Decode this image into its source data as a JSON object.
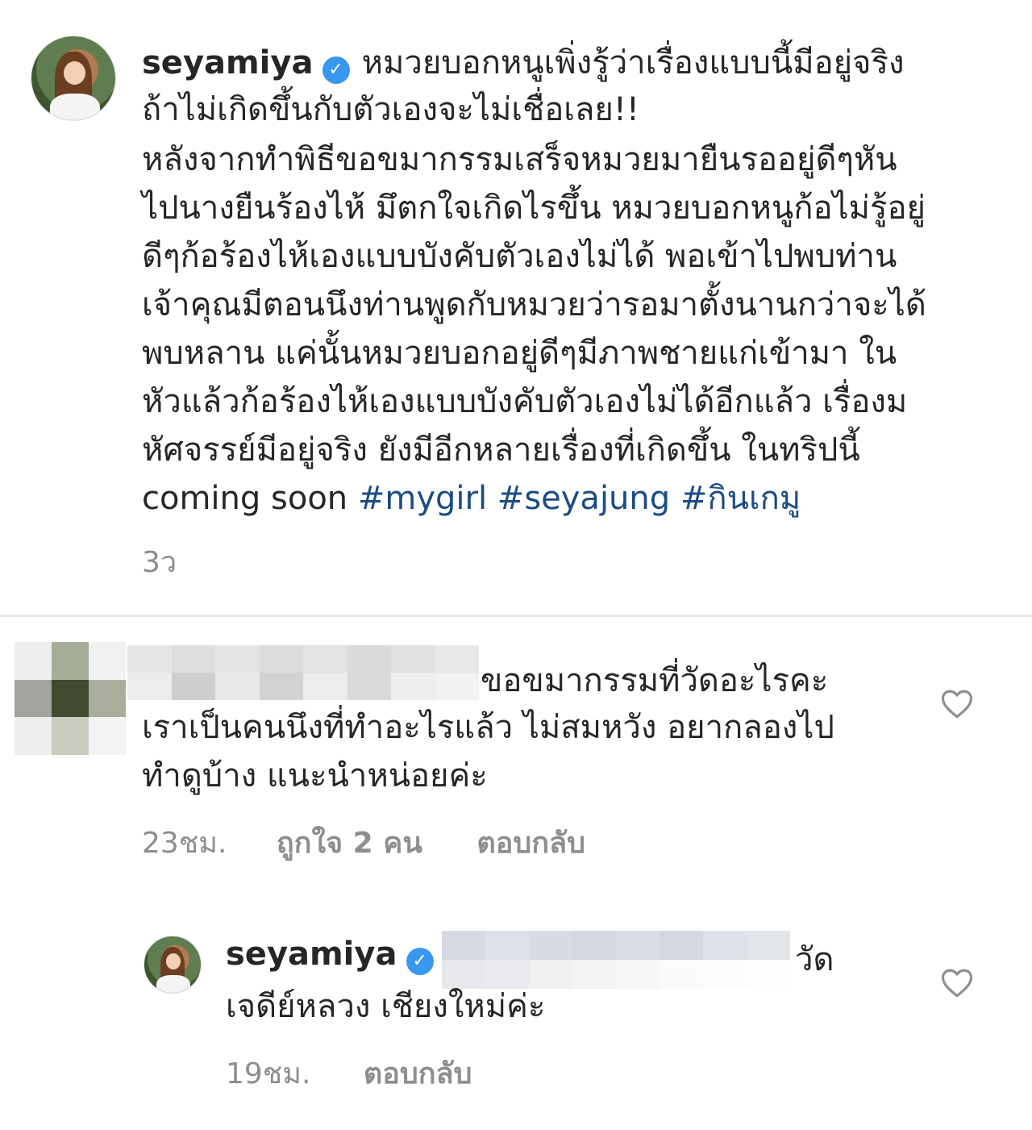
{
  "post": {
    "username": "seyamiya",
    "caption_lines": [
      "หมวยบอกหนูเพิ่งรู้ว่าเรื่องแบบนี้มีอยู่จริง",
      "ถ้าไม่เกิดขึ้นกับตัวเองจะไม่เชื่อเลย!!",
      "หลังจากทำพิธีขอขมากรรมเสร็จหมวยมายืนรออยู่ดีๆหัน",
      "ไปนางยืนร้องไห้ มึตกใจเกิดไรขึ้น หมวยบอกหนูก้อไม่รู้อยู่",
      "ดีๆก้อร้องไห้เองแบบบังคับตัวเองไม่ได้ พอเข้าไปพบท่าน",
      "เจ้าคุณมีตอนนึงท่านพูดกับหมวยว่ารอมาตั้งนานกว่าจะได้",
      "พบหลาน แค่นั้นหมวยบอกอยู่ดีๆมีภาพชายแก่เข้ามา ใน",
      "หัวแล้วก้อร้องไห้เองแบบบังคับตัวเองไม่ได้อีกแล้ว เรื่องม",
      "หัศจรรย์มีอยู่จริง ยังมีอีกหลายเรื่องที่เกิดขึ้น ในทริปนี้"
    ],
    "last_line_text": "coming soon",
    "hashtags": [
      "#mygirl",
      "#seyajung",
      "#กินเกมู"
    ],
    "time": "3ว"
  },
  "comment": {
    "text_line1": "ขอขมากรรมที่วัดอะไรคะ",
    "text_line2": "เราเป็นคนนึงที่ทำอะไรแล้ว ไม่สมหวัง อยากลองไป",
    "text_line3": "ทำดูบ้าง แนะนำหน่อยค่ะ",
    "time": "23ชม.",
    "likes": "ถูกใจ 2 คน",
    "reply_label": "ตอบกลับ"
  },
  "reply": {
    "username": "seyamiya",
    "text_line1": "วัด",
    "text_line2": "เจดีย์หลวง เชียงใหม่ค่ะ",
    "time": "19ชม.",
    "reply_label": "ตอบกลับ"
  }
}
